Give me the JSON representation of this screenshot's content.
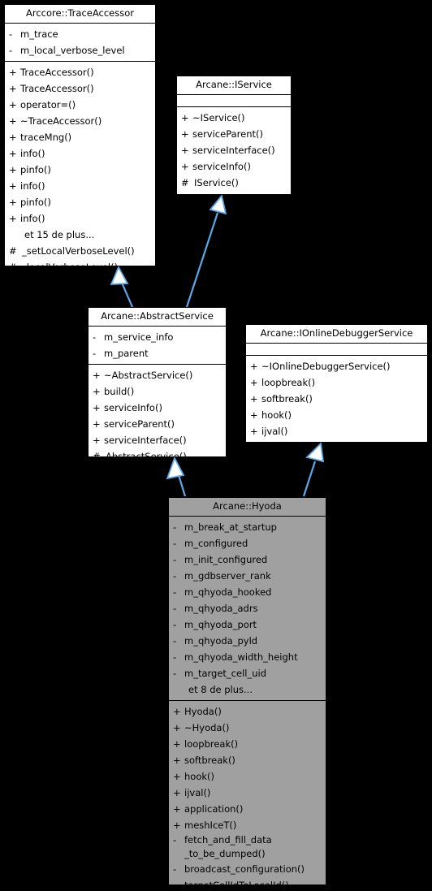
{
  "diagram": {
    "type": "uml-class-inheritance",
    "background_color": "#000000",
    "edge_color": "#5ea8e8",
    "classes": [
      {
        "id": "trace_accessor",
        "name": "Arccore::TraceAccessor",
        "fill": "#ffffff",
        "attributes": [
          {
            "vis": "-",
            "label": "m_trace"
          },
          {
            "vis": "-",
            "label": "m_local_verbose_level"
          }
        ],
        "methods": [
          {
            "vis": "+",
            "label": "TraceAccessor()"
          },
          {
            "vis": "+",
            "label": "TraceAccessor()"
          },
          {
            "vis": "+",
            "label": "operator=()"
          },
          {
            "vis": "+",
            "label": "~TraceAccessor()"
          },
          {
            "vis": "+",
            "label": "traceMng()"
          },
          {
            "vis": "+",
            "label": "info()"
          },
          {
            "vis": "+",
            "label": "pinfo()"
          },
          {
            "vis": "+",
            "label": "info()"
          },
          {
            "vis": "+",
            "label": "pinfo()"
          },
          {
            "vis": "+",
            "label": "info()"
          },
          {
            "vis": "",
            "label": "et 15 de plus..."
          },
          {
            "vis": "#",
            "label": "_setLocalVerboseLevel()"
          },
          {
            "vis": "#",
            "label": "_localVerboseLevel()"
          }
        ]
      },
      {
        "id": "iservice",
        "name": "Arcane::IService",
        "fill": "#ffffff",
        "attributes": [],
        "methods": [
          {
            "vis": "+",
            "label": "~IService()"
          },
          {
            "vis": "+",
            "label": "serviceParent()"
          },
          {
            "vis": "+",
            "label": "serviceInterface()"
          },
          {
            "vis": "+",
            "label": "serviceInfo()"
          },
          {
            "vis": "#",
            "label": "IService()"
          }
        ]
      },
      {
        "id": "abstract_service",
        "name": "Arcane::AbstractService",
        "fill": "#ffffff",
        "attributes": [
          {
            "vis": "-",
            "label": "m_service_info"
          },
          {
            "vis": "-",
            "label": "m_parent"
          }
        ],
        "methods": [
          {
            "vis": "+",
            "label": "~AbstractService()"
          },
          {
            "vis": "+",
            "label": "build()"
          },
          {
            "vis": "+",
            "label": "serviceInfo()"
          },
          {
            "vis": "+",
            "label": "serviceParent()"
          },
          {
            "vis": "+",
            "label": "serviceInterface()"
          },
          {
            "vis": "#",
            "label": "AbstractService()"
          }
        ]
      },
      {
        "id": "ionline_debugger_service",
        "name": "Arcane::IOnlineDebuggerService",
        "fill": "#ffffff",
        "attributes": [],
        "methods": [
          {
            "vis": "+",
            "label": "~IOnlineDebuggerService()"
          },
          {
            "vis": "+",
            "label": "loopbreak()"
          },
          {
            "vis": "+",
            "label": "softbreak()"
          },
          {
            "vis": "+",
            "label": "hook()"
          },
          {
            "vis": "+",
            "label": "ijval()"
          }
        ]
      },
      {
        "id": "hyoda",
        "name": "Arcane::Hyoda",
        "fill": "#a0a0a0",
        "attributes": [
          {
            "vis": "-",
            "label": "m_break_at_startup"
          },
          {
            "vis": "-",
            "label": "m_configured"
          },
          {
            "vis": "-",
            "label": "m_init_configured"
          },
          {
            "vis": "-",
            "label": "m_gdbserver_rank"
          },
          {
            "vis": "-",
            "label": "m_qhyoda_hooked"
          },
          {
            "vis": "-",
            "label": "m_qhyoda_adrs"
          },
          {
            "vis": "-",
            "label": "m_qhyoda_port"
          },
          {
            "vis": "-",
            "label": "m_qhyoda_pyld"
          },
          {
            "vis": "-",
            "label": "m_qhyoda_width_height"
          },
          {
            "vis": "-",
            "label": "m_target_cell_uid"
          },
          {
            "vis": "",
            "label": "et 8 de plus..."
          }
        ],
        "methods": [
          {
            "vis": "+",
            "label": "Hyoda()"
          },
          {
            "vis": "+",
            "label": "~Hyoda()"
          },
          {
            "vis": "+",
            "label": "loopbreak()"
          },
          {
            "vis": "+",
            "label": "softbreak()"
          },
          {
            "vis": "+",
            "label": "hook()"
          },
          {
            "vis": "+",
            "label": "ijval()"
          },
          {
            "vis": "+",
            "label": "application()"
          },
          {
            "vis": "+",
            "label": "meshIceT()"
          },
          {
            "vis": "-",
            "label": "fetch_and_fill_data\n_to_be_dumped()",
            "two_line": true
          },
          {
            "vis": "-",
            "label": "broadcast_configuration()"
          },
          {
            "vis": "-",
            "label": "targetCellIdToLocalId()"
          }
        ]
      }
    ],
    "inheritance_edges": [
      {
        "from": "abstract_service",
        "to": "trace_accessor"
      },
      {
        "from": "abstract_service",
        "to": "iservice"
      },
      {
        "from": "hyoda",
        "to": "abstract_service"
      },
      {
        "from": "hyoda",
        "to": "ionline_debugger_service"
      }
    ]
  }
}
